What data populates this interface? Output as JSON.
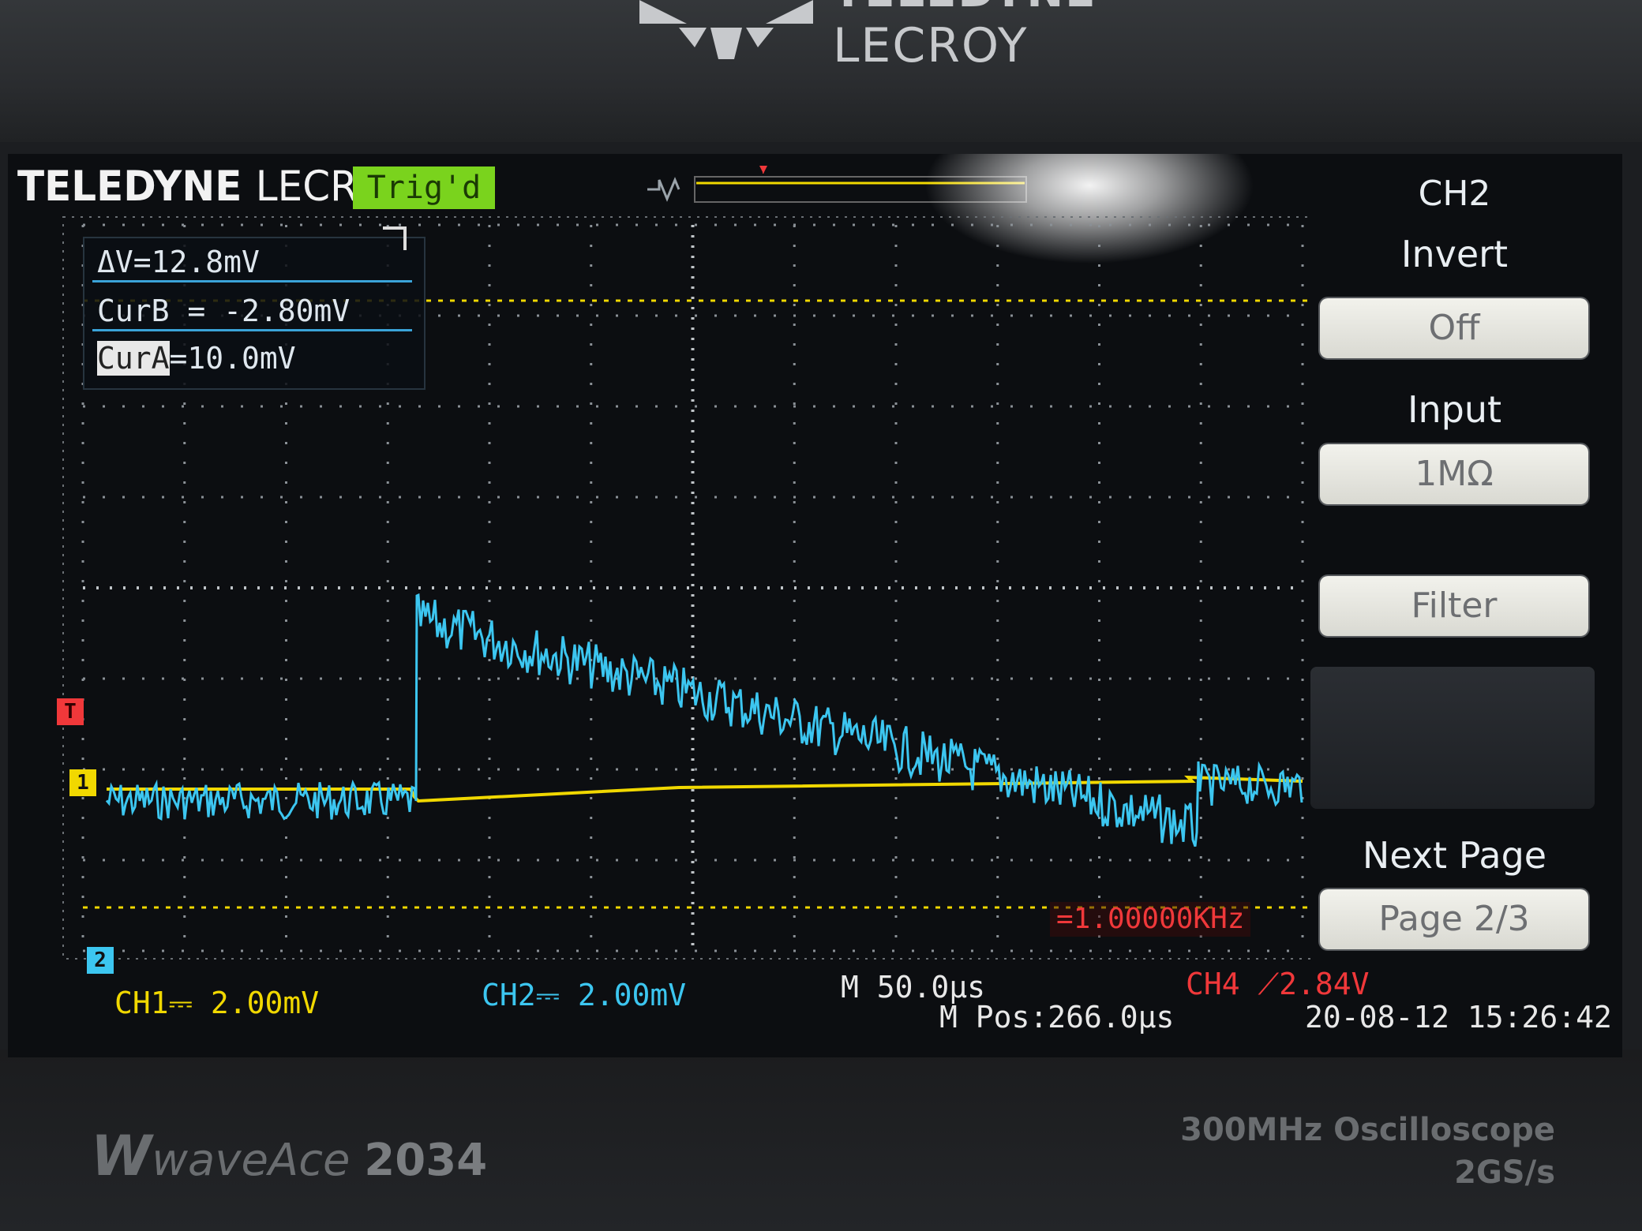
{
  "device": {
    "brand_line1": "TELEDYNE",
    "brand_line2": "LECROY",
    "model_prefix": "W",
    "model_name": "waveAce",
    "model_number": "2034",
    "spec_line1": "300MHz Oscilloscope",
    "spec_line2": "2GS/s"
  },
  "screen": {
    "logo_bold": "TELEDYNE",
    "logo_light": "LECROY",
    "trigger_status": "Trig'd",
    "trigger_marker": "T"
  },
  "cursors": {
    "delta": "ΔV=12.8mV",
    "cur_b": "CurB = -2.80mV",
    "cur_a_label": "CurA",
    "cur_a_value": "=10.0mV"
  },
  "menu": {
    "title": "CH2",
    "invert_label": "Invert",
    "invert_value": "Off",
    "input_label": "Input",
    "input_value": "1MΩ",
    "filter_label": "Filter",
    "next_page_label": "Next Page",
    "page_value": "Page 2/3"
  },
  "status": {
    "ch1": "CH1⎓ 2.00mV",
    "ch2": "CH2⎓ 2.00mV",
    "timebase": "M 50.0μs",
    "mpos": "M Pos:266.0μs",
    "ch4_trigger": "CH4 ⟋2.84V",
    "datetime": "20-08-12 15:26:42",
    "frequency": "=1.00000KHz"
  },
  "markers": {
    "trigger_level": "T",
    "ch1": "1",
    "ch2": "2"
  },
  "colors": {
    "ch1": "#f1d800",
    "ch2": "#3cc6f0",
    "ch4": "#f0383a",
    "trig_badge": "#7ad31d"
  }
}
